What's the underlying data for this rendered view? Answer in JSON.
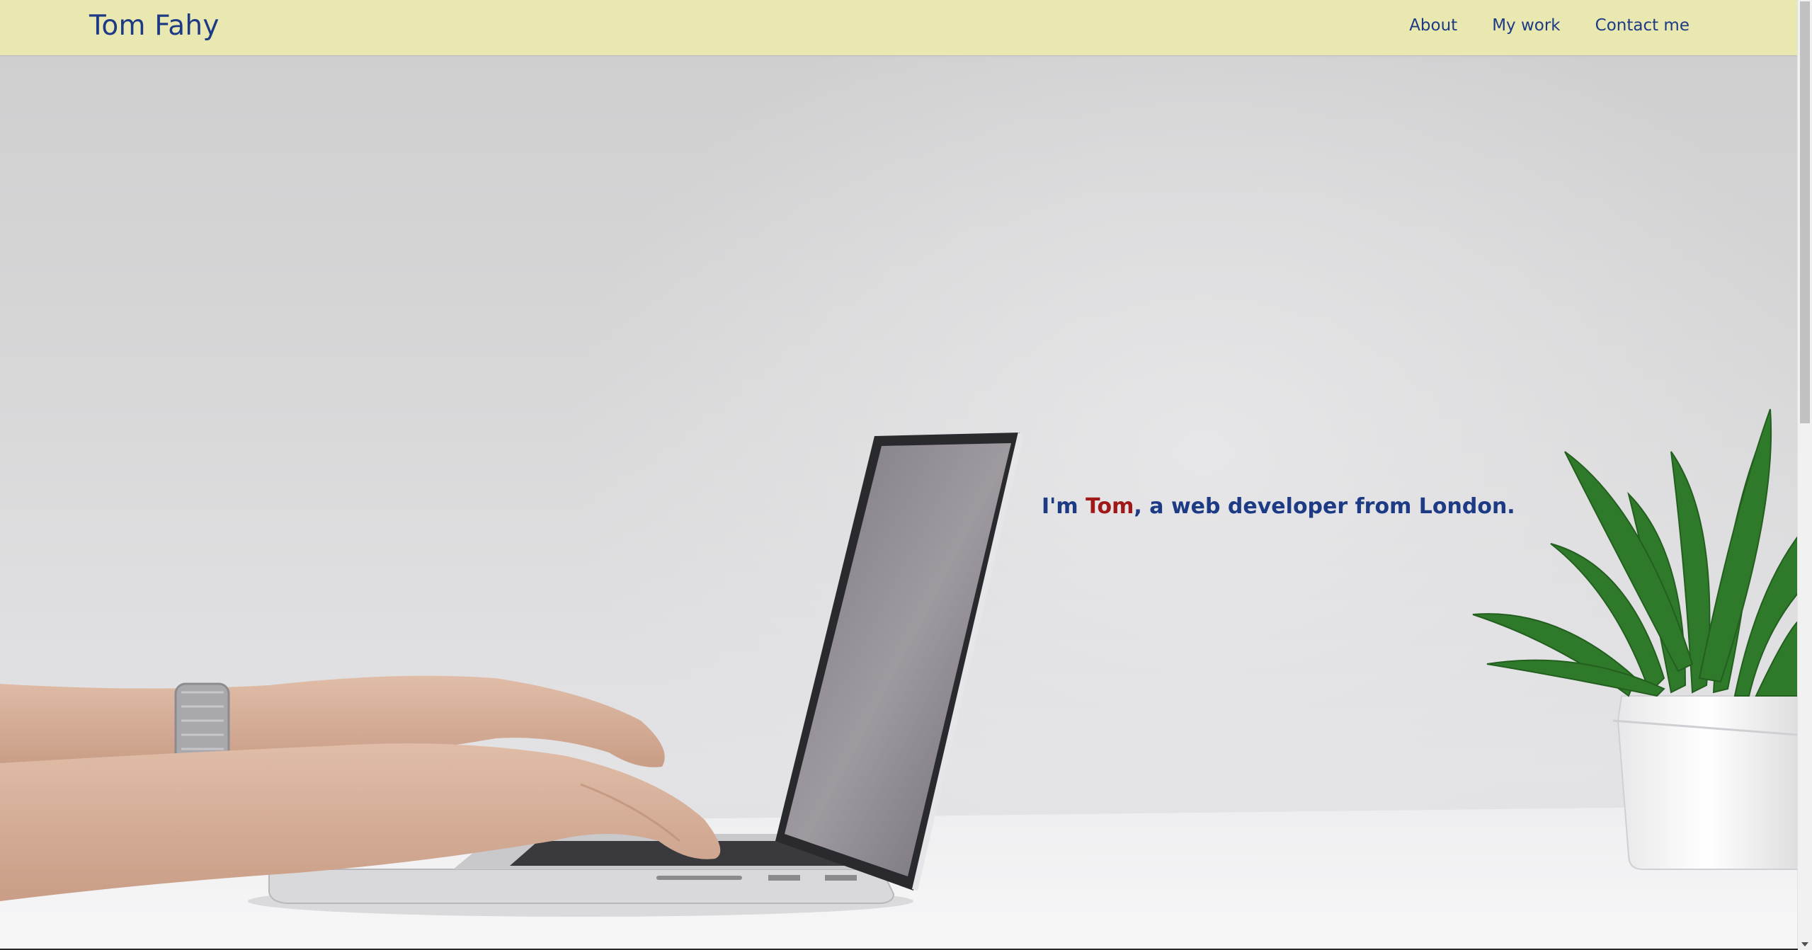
{
  "header": {
    "brand": "Tom Fahy",
    "nav": [
      {
        "label": "About"
      },
      {
        "label": "My work"
      },
      {
        "label": "Contact me"
      }
    ]
  },
  "hero": {
    "tagline_prefix": "I'm ",
    "tagline_name": "Tom",
    "tagline_suffix": ", a web developer from London.",
    "background_image": "laptop-typing-hands-with-plant-photo"
  },
  "colors": {
    "navbar_bg": "#e9e8b0",
    "primary_text": "#1d3a84",
    "name_highlight": "#a01818"
  }
}
